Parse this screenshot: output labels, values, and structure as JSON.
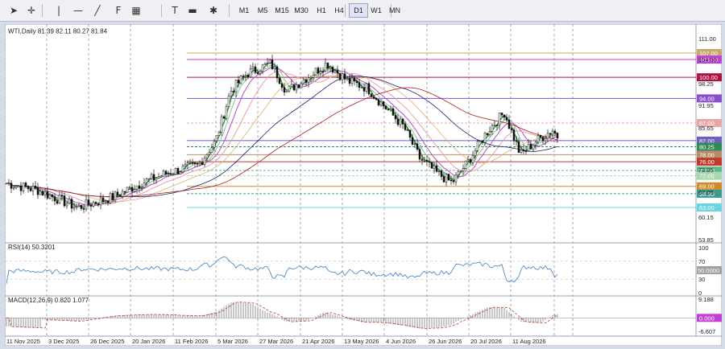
{
  "toolbar": {
    "tools": [
      {
        "name": "cursor-icon",
        "glyph": "➤"
      },
      {
        "name": "crosshair-icon",
        "glyph": "✛"
      },
      {
        "name": "vertical-line-icon",
        "glyph": "|"
      },
      {
        "name": "horizontal-line-icon",
        "glyph": "—"
      },
      {
        "name": "trendline-icon",
        "glyph": "╱"
      },
      {
        "name": "fibonacci-icon",
        "glyph": "F"
      },
      {
        "name": "channel-icon",
        "glyph": "▦"
      },
      {
        "name": "text-icon",
        "glyph": "T"
      },
      {
        "name": "label-icon",
        "glyph": "▬"
      },
      {
        "name": "shapes-icon",
        "glyph": "✱"
      }
    ],
    "timeframes": [
      "M1",
      "M5",
      "M15",
      "M30",
      "H1",
      "H4",
      "D1",
      "W1",
      "MN"
    ],
    "active_timeframe": "D1"
  },
  "main_chart": {
    "symbol_info": "WTI,Daily  81.39 82.11 80.27 81.84",
    "price_scale": [
      "111.00",
      "104.36",
      "98.25",
      "91.95",
      "85.65",
      "73.35",
      "67.05",
      "60.15",
      "53.85"
    ],
    "level_labels": [
      {
        "text": "107.00",
        "bg": "#c8a76a",
        "fg": "#ffffff"
      },
      {
        "text": "105.00",
        "bg": "#c43fd6",
        "fg": "#ffffff"
      },
      {
        "text": "100.00",
        "bg": "#b0113f",
        "fg": "#ffffff"
      },
      {
        "text": "94.00",
        "bg": "#8a4fcf",
        "fg": "#ffffff"
      },
      {
        "text": "87.00",
        "bg": "#e9a6a6",
        "fg": "#ffffff"
      },
      {
        "text": "82.00",
        "bg": "#6b62c0",
        "fg": "#ffffff"
      },
      {
        "text": "80.25",
        "bg": "#2e8b57",
        "fg": "#ffffff"
      },
      {
        "text": "78.00",
        "bg": "#b98a6a",
        "fg": "#ffffff"
      },
      {
        "text": "76.00",
        "bg": "#c0392b",
        "fg": "#ffffff"
      },
      {
        "text": "73.50",
        "bg": "#5fb88a",
        "fg": "#ffffff"
      },
      {
        "text": "72.00",
        "bg": "#a8d8b0",
        "fg": "#ffffff"
      },
      {
        "text": "69.00",
        "bg": "#d08a2a",
        "fg": "#ffffff"
      },
      {
        "text": "66.90",
        "bg": "#3a9d8f",
        "fg": "#ffffff"
      },
      {
        "text": "63.00",
        "bg": "#6ad4e0",
        "fg": "#ffffff"
      }
    ]
  },
  "rsi": {
    "title": "RSI(14) 50.3201",
    "scale": [
      "100",
      "70",
      "30",
      "0"
    ],
    "current_label": "50.0000"
  },
  "macd": {
    "title": "MACD(12,26,9) 0.820 1.077",
    "scale": [
      "9.188",
      "-6.607"
    ],
    "current_label": "0.000"
  },
  "date_axis": [
    "11 Nov 2025",
    "3 Dec 2025",
    "26 Dec 2025",
    "20 Jan 2026",
    "11 Feb 2026",
    "5 Mar 2026",
    "27 Mar 2026",
    "21 Apr 2026",
    "13 May 2026",
    "4 Jun 2026",
    "26 Jun 2026",
    "20 Jul 2026",
    "11 Aug 2026"
  ]
}
